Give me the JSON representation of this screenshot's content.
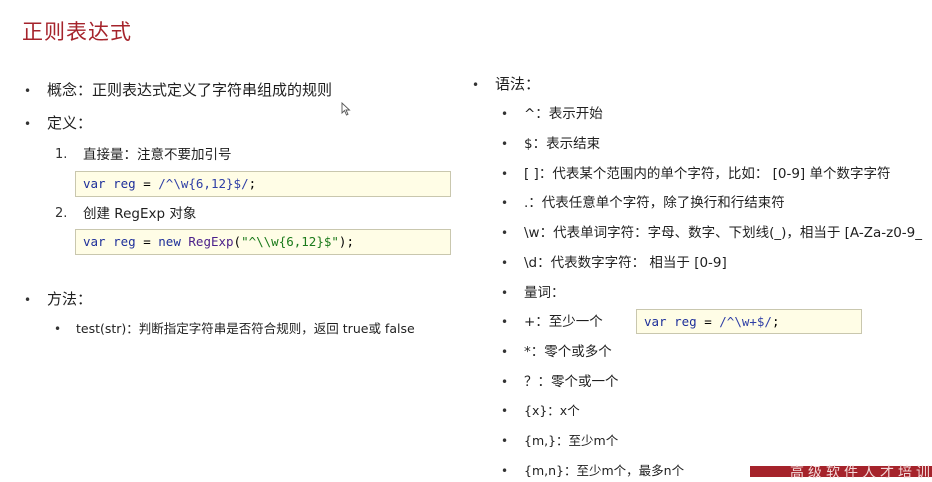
{
  "title": "正则表达式",
  "left": {
    "concept": "概念：正则表达式定义了字符串组成的规则",
    "definition": "定义：",
    "def_items": [
      {
        "num": "1.",
        "text": "直接量：注意不要加引号"
      },
      {
        "num": "2.",
        "text": "创建 RegExp 对象"
      }
    ],
    "code1": {
      "kw": "var",
      "name": " reg ",
      "eq": "= ",
      "regex": "/^\\w{6,12}$/",
      "end": ";"
    },
    "code2": {
      "kw": "var",
      "name": " reg ",
      "eq": "= ",
      "new": "new ",
      "fn": "RegExp",
      "open": "(",
      "str": "\"^\\\\w{6,12}$\"",
      "close": ");"
    },
    "methods": "方法：",
    "method_item": "test(str)：判断指定字符串是否符合规则，返回 true或 false"
  },
  "right": {
    "syntax": "语法：",
    "items": [
      "^：表示开始",
      "$：表示结束",
      "[ ]：代表某个范围内的单个字符，比如： [0-9] 单个数字字符",
      ".：代表任意单个字符，除了换行和行结束符",
      "\\w：代表单词字符：字母、数字、下划线(_)，相当于 [A-Za-z0-9_",
      "\\d：代表数字字符： 相当于 [0-9]",
      "量词：",
      "+：至少一个",
      "*：零个或多个",
      "？：零个或一个",
      "{x}：x个",
      "{m,}：至少m个",
      "{m,n}：至少m个，最多n个"
    ],
    "code3": {
      "kw": "var",
      "name": " reg ",
      "eq": "= ",
      "regex": "/^\\w+$/",
      "end": ";"
    }
  },
  "footer": "高级软件人才培训专"
}
